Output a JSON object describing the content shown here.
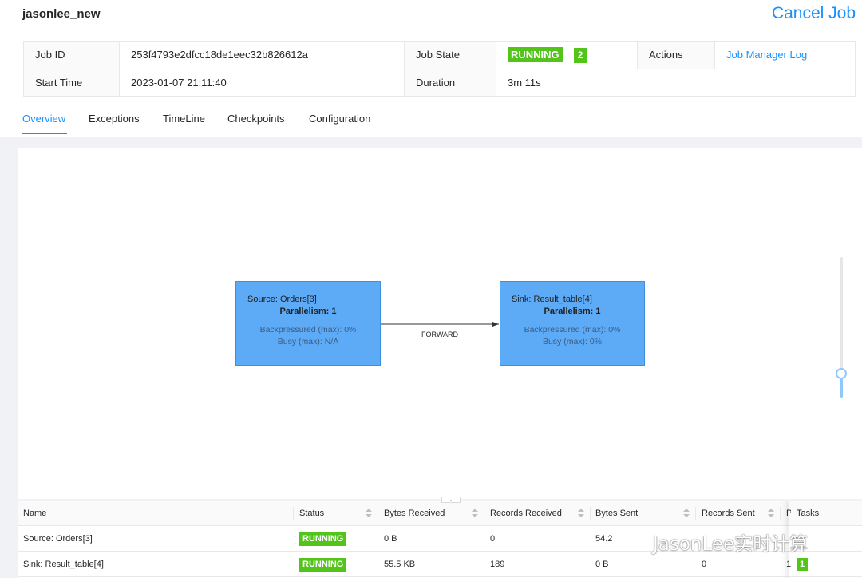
{
  "header": {
    "job_name": "jasonlee_new",
    "cancel_label": "Cancel Job"
  },
  "info": {
    "job_id_label": "Job ID",
    "job_id": "253f4793e2dfcc18de1eec32b826612a",
    "job_state_label": "Job State",
    "job_state": "RUNNING",
    "job_state_count": "2",
    "actions_label": "Actions",
    "actions_link": "Job Manager Log",
    "start_time_label": "Start Time",
    "start_time": "2023-01-07 21:11:40",
    "duration_label": "Duration",
    "duration": "3m 11s"
  },
  "tabs": [
    "Overview",
    "Exceptions",
    "TimeLine",
    "Checkpoints",
    "Configuration"
  ],
  "graph": {
    "nodes": [
      {
        "name": "Source: Orders[3]",
        "parallelism": "Parallelism: 1",
        "backpressured": "Backpressured (max): 0%",
        "busy": "Busy (max): N/A"
      },
      {
        "name": "Sink: Result_table[4]",
        "parallelism": "Parallelism: 1",
        "backpressured": "Backpressured (max): 0%",
        "busy": "Busy (max): 0%"
      }
    ],
    "edge_label": "FORWARD",
    "resizer_label": "…"
  },
  "table": {
    "columns": [
      "Name",
      "Status",
      "Bytes Received",
      "Records Received",
      "Bytes Sent",
      "Records Sent",
      "P",
      "Tasks"
    ],
    "rows": [
      {
        "name": "Source: Orders[3]",
        "status": "RUNNING",
        "bytes_received": "0 B",
        "records_received": "0",
        "bytes_sent": "54.2",
        "records_sent": "",
        "p": "",
        "tasks": ""
      },
      {
        "name": "Sink: Result_table[4]",
        "status": "RUNNING",
        "bytes_received": "55.5 KB",
        "records_received": "189",
        "bytes_sent": "0 B",
        "records_sent": "0",
        "p": "1",
        "tasks": "1"
      }
    ],
    "row_menu": "⋮"
  },
  "watermark": "JasonLee实时计算",
  "colors": {
    "accent": "#1890ff",
    "running": "#52c41a",
    "node_fill": "#5daaf7"
  }
}
